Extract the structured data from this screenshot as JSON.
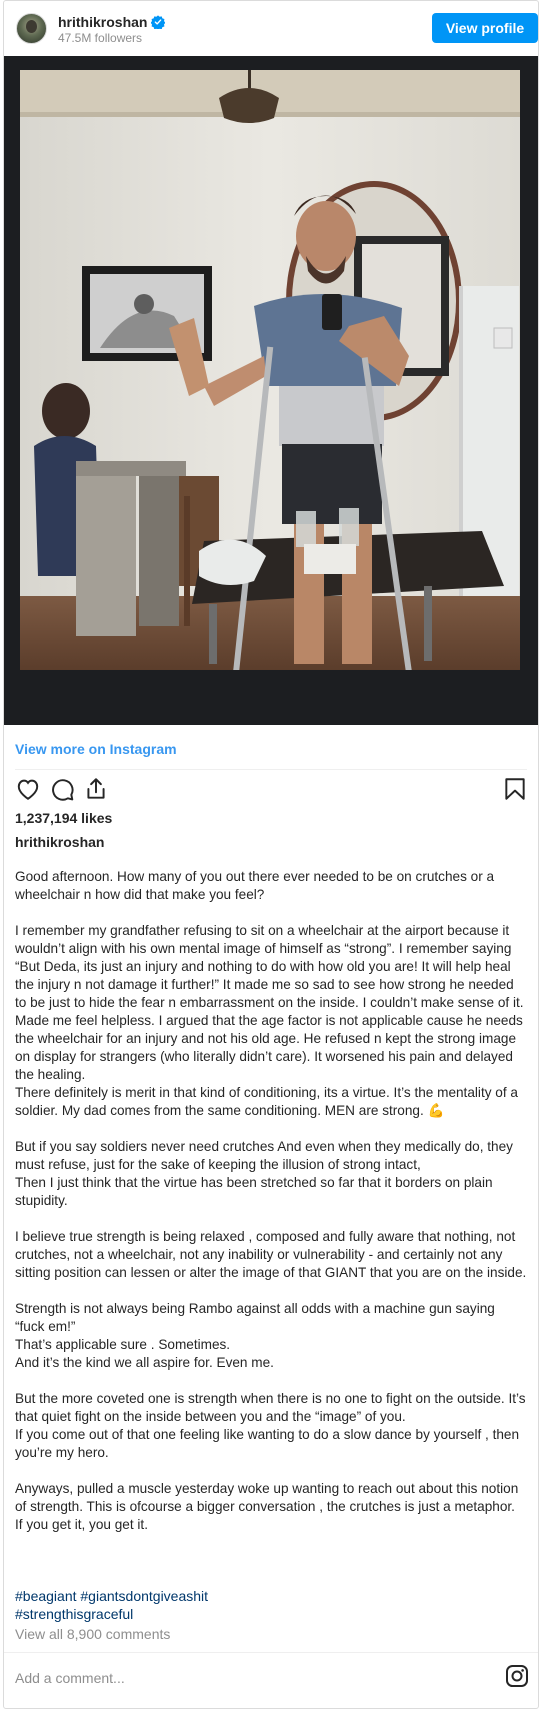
{
  "header": {
    "username": "hrithikroshan",
    "followers": "47.5M followers",
    "view_profile_label": "View profile"
  },
  "post": {
    "view_more_label": "View more on Instagram",
    "likes": "1,237,194 likes",
    "author": "hrithikroshan",
    "caption": [
      "Good afternoon. How many of you out there ever needed to be on crutches or a wheelchair n how did that make you feel?",
      "I remember my grandfather refusing to sit on a wheelchair at the airport because it wouldn’t align with his own mental image of himself as “strong”. I remember saying “But Deda, its just an injury and nothing to do with how old you are! It will help heal the injury n not damage it further!” It made me so sad to see how strong he needed to be just to hide the fear n embarrassment on the inside. I couldn’t make sense of it. Made me feel helpless. I argued that the age factor is not applicable cause he needs the wheelchair for an injury and not his old age. He refused n kept the strong image on display for strangers (who literally didn’t care). It worsened his pain and delayed the healing.\nThere definitely is merit in that kind of conditioning, its a virtue. It’s the mentality of a soldier. My dad comes from the same conditioning. MEN are strong. 💪",
      "But if you say soldiers never need crutches And even when they medically do, they must refuse, just for the sake of keeping the illusion of strong intact,\nThen I just think that the virtue has been stretched so far that it borders on plain stupidity.",
      "I believe true strength is being relaxed , composed and fully aware that nothing, not crutches, not a wheelchair, not any inability or vulnerability - and certainly not any sitting position can lessen or alter the image of that GIANT that you are on the inside.",
      "Strength is not always being Rambo against all odds with a machine gun saying “fuck em!”\nThat’s applicable sure . Sometimes.\nAnd it’s the kind we all aspire for. Even me.",
      "But the more coveted one is strength when there is no one to fight on the outside. It’s that quiet fight on the inside between you and the “image” of you.\nIf you come out of that one feeling like wanting to do a slow dance by yourself , then you’re my hero.",
      "Anyways, pulled a muscle yesterday woke up wanting to reach out about this notion of strength. This is ofcourse a bigger conversation , the crutches is just a metaphor.\nIf you get it, you get it."
    ],
    "hashtags_line1": "#beagiant #giantsdontgiveashit",
    "hashtags_line2": "#strengthisgraceful",
    "view_comments": "View all 8,900 comments",
    "comment_placeholder": "Add a comment..."
  },
  "icons": {
    "verified": "verified-badge-icon",
    "like": "heart-icon",
    "comment": "comment-icon",
    "share": "share-icon",
    "save": "bookmark-icon",
    "instagram": "instagram-logo-icon"
  },
  "colors": {
    "accent": "#0095f6",
    "link": "#3897f0",
    "hashtag": "#00376b",
    "muted": "#8e8e8e"
  }
}
